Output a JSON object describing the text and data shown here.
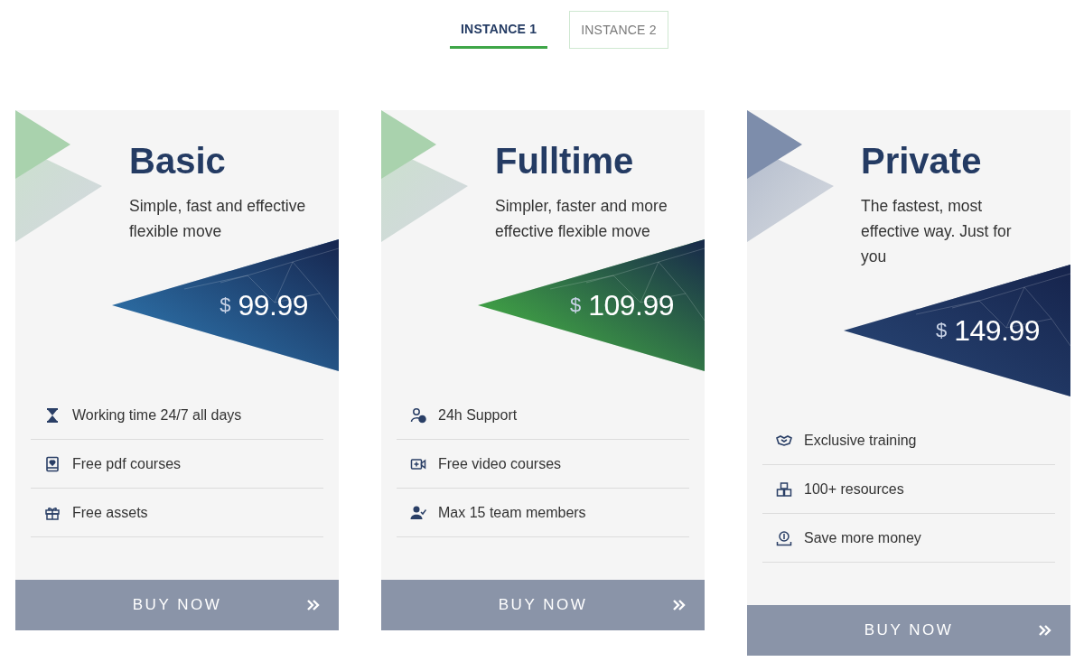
{
  "tabs": [
    {
      "label": "INSTANCE 1",
      "selected": true
    },
    {
      "label": "INSTANCE 2",
      "selected": false
    }
  ],
  "plans": [
    {
      "name": "Basic",
      "description": "Simple, fast and effective flexible move",
      "currency": "$",
      "price": "99.99",
      "color": "#2b6aa0",
      "decoration": {
        "color": "#a9d2ad"
      },
      "features": [
        "Working time 24/7 all days",
        "Free pdf courses",
        "Free assets"
      ],
      "button": "BUY NOW"
    },
    {
      "name": "Fulltime",
      "description": "Simpler, faster and more effective flexible move",
      "currency": "$",
      "price": "109.99",
      "color": "#3f9e45",
      "decoration": {
        "color": "#a9d2ad"
      },
      "features": [
        "24h Support",
        "Free video courses",
        "Max 15 team members"
      ],
      "button": "BUY NOW"
    },
    {
      "name": "Private",
      "description": "The fastest, most effective way. Just for you",
      "currency": "$",
      "price": "149.99",
      "color": "#25406e",
      "decoration": {
        "color": "#7d8dab"
      },
      "features": [
        "Exclusive training",
        "100+ resources",
        "Save more money"
      ],
      "button": "BUY NOW"
    }
  ]
}
